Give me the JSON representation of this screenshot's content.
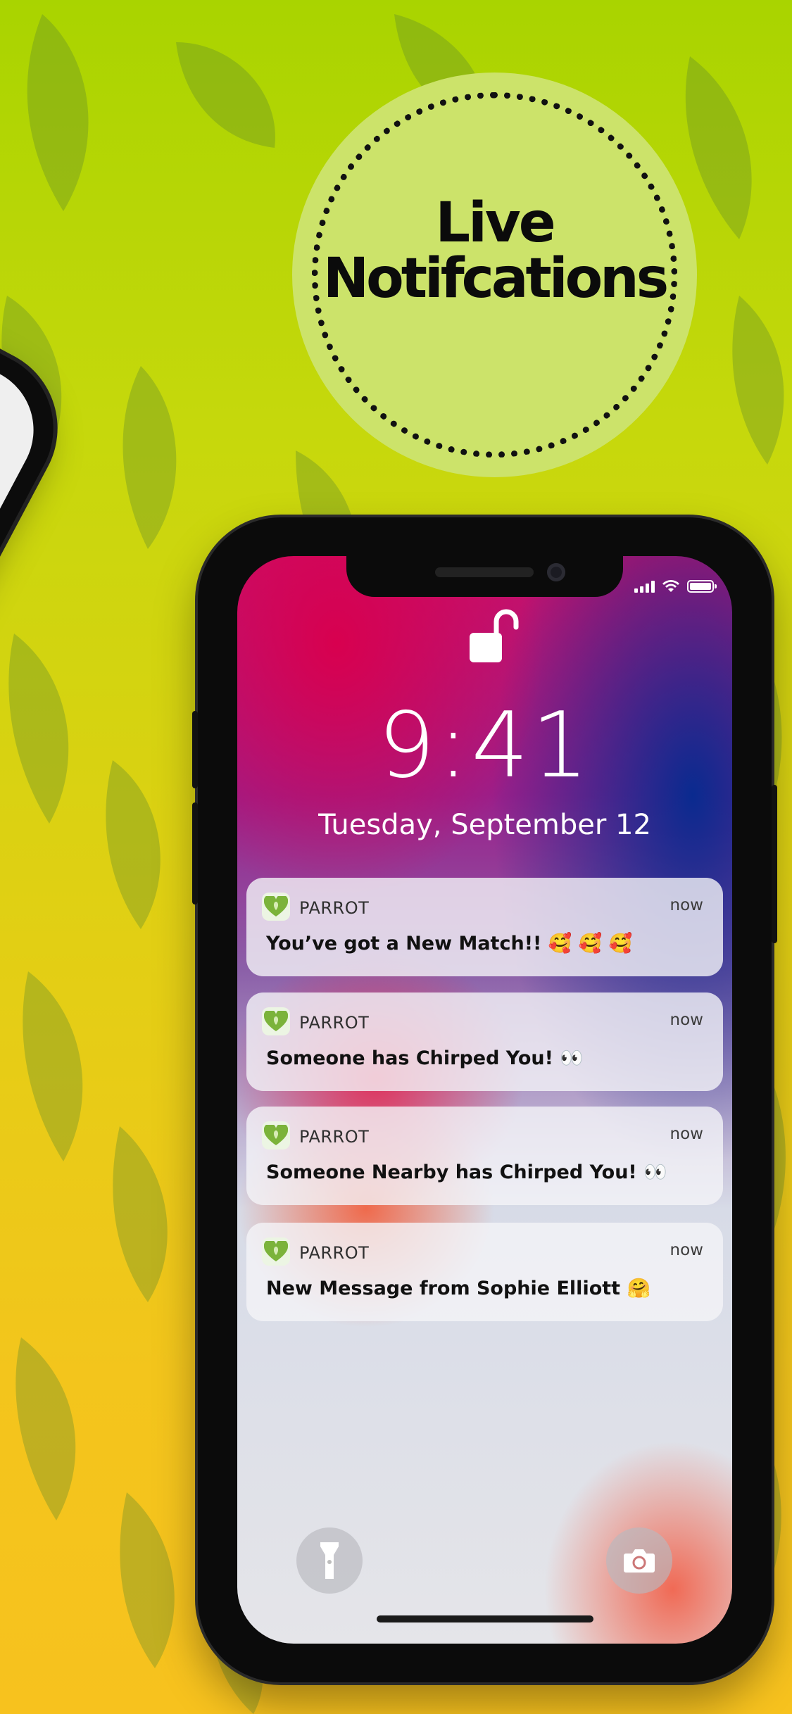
{
  "badge": {
    "title_line1": "Live",
    "title_line2": "Notifcations"
  },
  "lock_screen": {
    "time": "9:41",
    "date": "Tuesday, September 12"
  },
  "notifications": [
    {
      "app": "PARROT",
      "time": "now",
      "message": "You’ve got a New Match!! 🥰 🥰 🥰",
      "icon": "parrot-app-icon"
    },
    {
      "app": "PARROT",
      "time": "now",
      "message": "Someone has Chirped You! 👀",
      "icon": "parrot-app-icon"
    },
    {
      "app": "PARROT",
      "time": "now",
      "message": "Someone Nearby has Chirped You! 👀",
      "icon": "parrot-app-icon"
    },
    {
      "app": "PARROT",
      "time": "now",
      "message": "New Message from Sophie Elliott 🤗",
      "icon": "parrot-app-icon"
    }
  ],
  "status_bar": {
    "icons": [
      "signal-icon",
      "wifi-icon",
      "battery-icon"
    ],
    "battery_level": 1.0
  },
  "quick_actions": [
    "flashlight-icon",
    "camera-icon"
  ],
  "colors": {
    "background_top": "#a9d400",
    "background_bottom": "#f7c21e",
    "badge": "#cce36a"
  }
}
